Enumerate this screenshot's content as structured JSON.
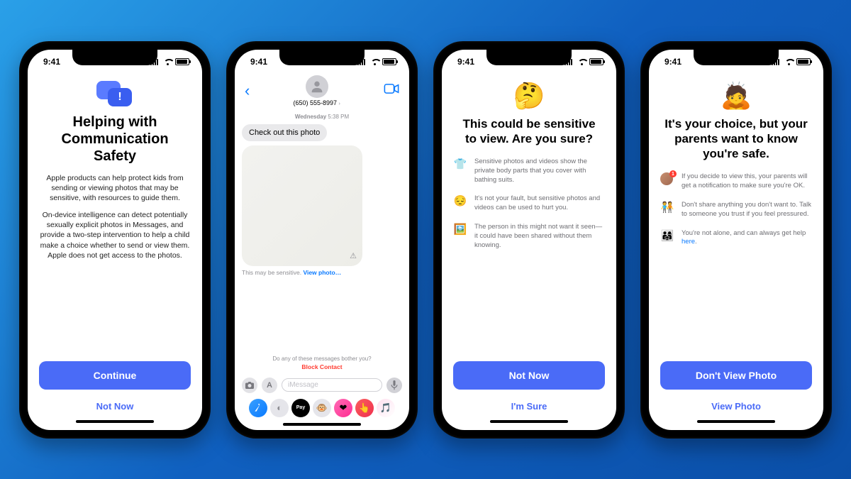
{
  "status": {
    "time": "9:41"
  },
  "phone1": {
    "title": "Helping with Communication Safety",
    "para1": "Apple products can help protect kids from sending or viewing photos that may be sensitive, with resources to guide them.",
    "para2": "On-device intelligence can detect potentially sexually explicit photos in Messages, and provide a two-step intervention to help a child make a choice whether to send or view them. Apple does not get access to the photos.",
    "continue": "Continue",
    "not_now": "Not Now"
  },
  "phone2": {
    "contact_number": "(650) 555-8997",
    "timestamp_day": "Wednesday",
    "timestamp_time": "5:38 PM",
    "message": "Check out this photo",
    "warning_prefix": "This may be sensitive. ",
    "warning_link": "View photo…",
    "bother_q": "Do any of these messages bother you?",
    "block": "Block Contact",
    "placeholder": "iMessage",
    "apple_pay": "Pay"
  },
  "phone3": {
    "emoji": "🤔",
    "title": "This could be sensitive to view. Are you sure?",
    "rows": [
      {
        "icon": "👕",
        "text": "Sensitive photos and videos show the private body parts that you cover with bathing suits."
      },
      {
        "icon": "😔",
        "text": "It's not your fault, but sensitive photos and videos can be used to hurt you."
      },
      {
        "icon": "🖼️",
        "text": "The person in this might not want it seen—it could have been shared without them knowing."
      }
    ],
    "primary": "Not Now",
    "secondary": "I'm Sure"
  },
  "phone4": {
    "emoji": "🙇",
    "title": "It's your choice, but your parents want to know you're safe.",
    "rows": [
      {
        "icon": "avatar",
        "badge": "1",
        "text": "If you decide to view this, your parents will get a notification to make sure you're OK."
      },
      {
        "icon": "🧑‍🤝‍🧑",
        "text": "Don't share anything you don't want to. Talk to someone you trust if you feel pressured."
      },
      {
        "icon": "👨‍👩‍👧",
        "text_pre": "You're not alone, and can always get help ",
        "link": "here",
        "text_post": "."
      }
    ],
    "primary": "Don't View Photo",
    "secondary": "View Photo"
  }
}
